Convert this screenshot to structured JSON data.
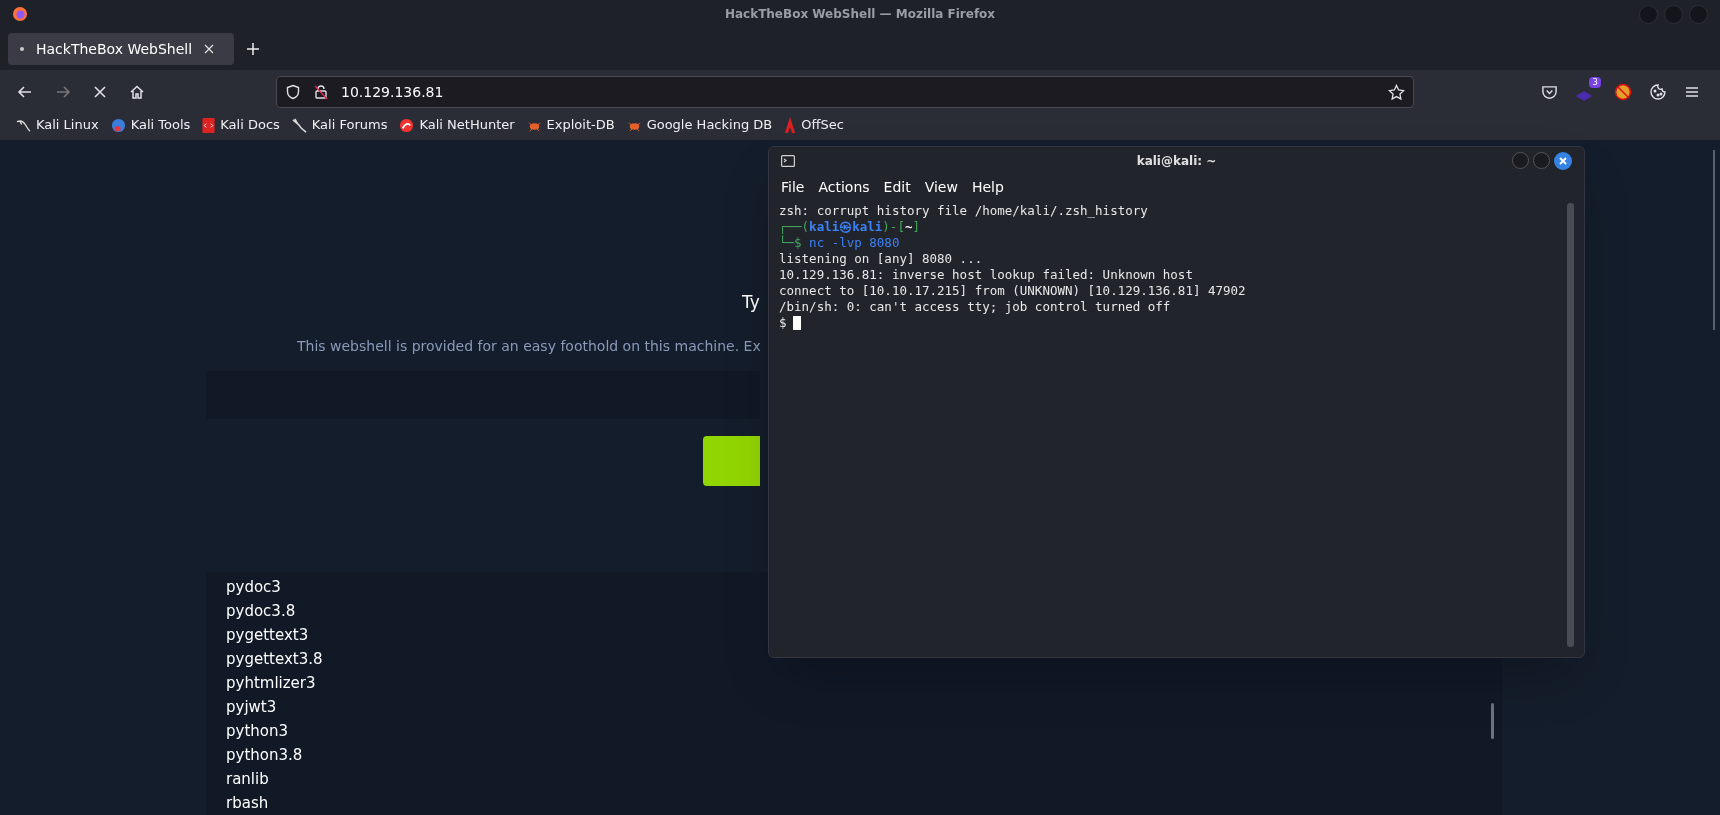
{
  "window": {
    "title": "HackTheBox WebShell — Mozilla Firefox"
  },
  "tabs": [
    {
      "label": "HackTheBox WebShell",
      "selected": true
    }
  ],
  "address_bar": {
    "url": "10.129.136.81"
  },
  "toolbar": {
    "extension_badge": "3"
  },
  "bookmarks": [
    "Kali Linux",
    "Kali Tools",
    "Kali Docs",
    "Kali Forums",
    "Kali NetHunter",
    "Exploit-DB",
    "Google Hacking DB",
    "OffSec"
  ],
  "page": {
    "heading": "Ty",
    "description": "This webshell is provided for an easy foothold on this machine. Ex",
    "output_lines": [
      "pydoc3",
      "pydoc3.8",
      "pygettext3",
      "pygettext3.8",
      "pyhtmlizer3",
      "pyjwt3",
      "python3",
      "python3.8",
      "ranlib",
      "rbash"
    ]
  },
  "terminal": {
    "title": "kali@kali: ~",
    "menu": [
      "File",
      "Actions",
      "Edit",
      "View",
      "Help"
    ],
    "lines": [
      {
        "kind": "text",
        "text": "zsh: corrupt history file /home/kali/.zsh_history"
      },
      {
        "kind": "prompt_header",
        "parts": [
          "┌──(",
          "kali㉿kali",
          ")-[",
          "~",
          "]"
        ]
      },
      {
        "kind": "prompt_command",
        "prompt": "└─$",
        "command": "nc -lvp 8080"
      },
      {
        "kind": "text",
        "text": "listening on [any] 8080 ..."
      },
      {
        "kind": "text",
        "text": "10.129.136.81: inverse host lookup failed: Unknown host"
      },
      {
        "kind": "text",
        "text": "connect to [10.10.17.215] from (UNKNOWN) [10.129.136.81] 47902"
      },
      {
        "kind": "text",
        "text": "/bin/sh: 0: can't access tty; job control turned off"
      },
      {
        "kind": "shell_prompt",
        "text": "$"
      }
    ]
  }
}
